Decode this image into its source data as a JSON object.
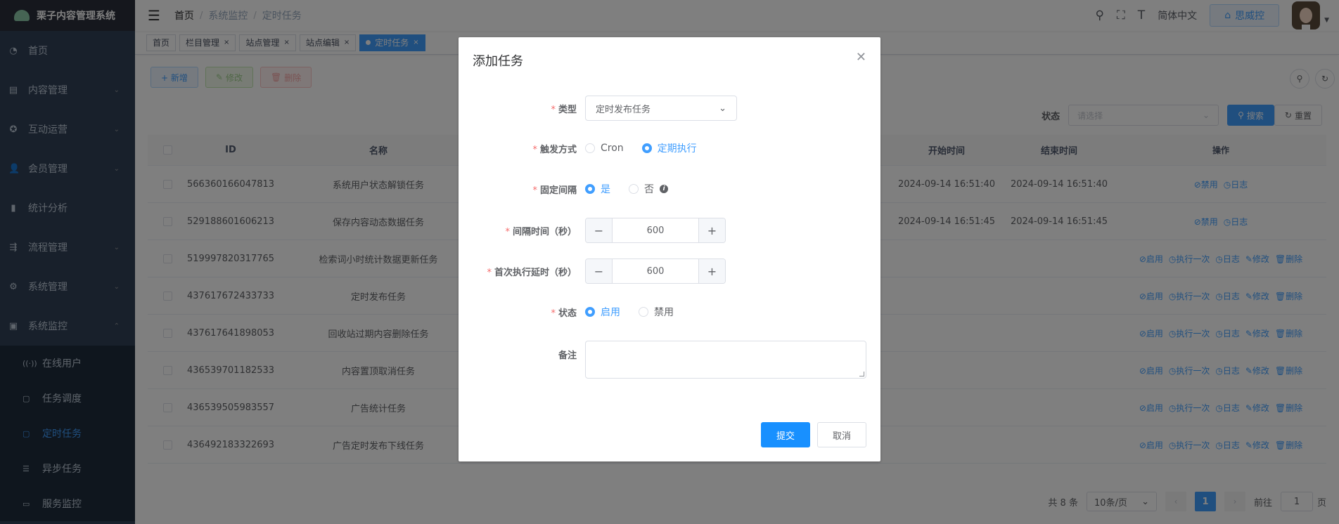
{
  "app": {
    "title": "栗子内容管理系统"
  },
  "sidebar": {
    "items": [
      {
        "label": "首页",
        "icon": "dashboard-icon",
        "glyph": "◔"
      },
      {
        "label": "内容管理",
        "icon": "document-icon",
        "glyph": "▤"
      },
      {
        "label": "互动运营",
        "icon": "interaction-icon",
        "glyph": "✪"
      },
      {
        "label": "会员管理",
        "icon": "user-icon",
        "glyph": "👤"
      },
      {
        "label": "统计分析",
        "icon": "chart-icon",
        "glyph": "▮"
      },
      {
        "label": "流程管理",
        "icon": "flow-icon",
        "glyph": "⇶"
      },
      {
        "label": "系统管理",
        "icon": "gear-icon",
        "glyph": "⚙"
      },
      {
        "label": "系统监控",
        "icon": "monitor-icon",
        "glyph": "▣"
      }
    ],
    "submenu": [
      {
        "label": "在线用户",
        "icon": "online-icon",
        "glyph": "((·))"
      },
      {
        "label": "任务调度",
        "icon": "schedule-icon",
        "glyph": "▢"
      },
      {
        "label": "定时任务",
        "icon": "timer-icon",
        "glyph": "▢"
      },
      {
        "label": "异步任务",
        "icon": "list-icon",
        "glyph": "☰"
      },
      {
        "label": "服务监控",
        "icon": "server-icon",
        "glyph": "▭"
      }
    ]
  },
  "navbar": {
    "breadcrumb": [
      "首页",
      "系统监控",
      "定时任务"
    ],
    "breadcrumb_sep": "/",
    "language": "简体中文",
    "portal_label": "思威控"
  },
  "tags": [
    {
      "label": "首页"
    },
    {
      "label": "栏目管理"
    },
    {
      "label": "站点管理"
    },
    {
      "label": "站点编辑"
    },
    {
      "label": "定时任务"
    }
  ],
  "toolbar": {
    "add": "+ 新增",
    "edit": "修改",
    "delete": "删除"
  },
  "filter": {
    "label": "状态",
    "placeholder": "请选择",
    "search": "搜索",
    "reset": "重置"
  },
  "table": {
    "headers": {
      "id": "ID",
      "name": "名称",
      "start": "开始时间",
      "end": "结束时间",
      "ops": "操作"
    },
    "rows": [
      {
        "id": "566360166047813",
        "name": "系统用户状态解锁任务",
        "start": "2024-09-14 16:51:40",
        "end": "2024-09-14 16:51:40",
        "ops": [
          "⊘禁用",
          "◷日志"
        ]
      },
      {
        "id": "529188601606213",
        "name": "保存内容动态数据任务",
        "start": "2024-09-14 16:51:45",
        "end": "2024-09-14 16:51:45",
        "ops": [
          "⊘禁用",
          "◷日志"
        ]
      },
      {
        "id": "519997820317765",
        "name": "检索词小时统计数据更新任务",
        "start": "",
        "end": "",
        "ops": [
          "⊘启用",
          "◷执行一次",
          "◷日志",
          "✎修改",
          "🗑删除"
        ]
      },
      {
        "id": "437617672433733",
        "name": "定时发布任务",
        "start": "",
        "end": "",
        "ops": [
          "⊘启用",
          "◷执行一次",
          "◷日志",
          "✎修改",
          "🗑删除"
        ]
      },
      {
        "id": "437617641898053",
        "name": "回收站过期内容删除任务",
        "start": "",
        "end": "",
        "ops": [
          "⊘启用",
          "◷执行一次",
          "◷日志",
          "✎修改",
          "🗑删除"
        ]
      },
      {
        "id": "436539701182533",
        "name": "内容置顶取消任务",
        "start": "",
        "end": "",
        "ops": [
          "⊘启用",
          "◷执行一次",
          "◷日志",
          "✎修改",
          "🗑删除"
        ]
      },
      {
        "id": "436539505983557",
        "name": "广告统计任务",
        "start": "",
        "end": "",
        "ops": [
          "⊘启用",
          "◷执行一次",
          "◷日志",
          "✎修改",
          "🗑删除"
        ]
      },
      {
        "id": "436492183322693",
        "name": "广告定时发布下线任务",
        "start": "",
        "end": "",
        "ops": [
          "⊘启用",
          "◷执行一次",
          "◷日志",
          "✎修改",
          "🗑删除"
        ]
      }
    ]
  },
  "pagination": {
    "total": "共 8 条",
    "page_size": "10条/页",
    "current": "1",
    "goto_prefix": "前往",
    "goto_value": "1",
    "goto_suffix": "页"
  },
  "dialog": {
    "title": "添加任务",
    "type_label": "类型",
    "type_value": "定时发布任务",
    "trigger_label": "触发方式",
    "trigger_options": [
      "Cron",
      "定期执行"
    ],
    "fixed_label": "固定间隔",
    "fixed_options": [
      "是",
      "否"
    ],
    "interval_label": "间隔时间（秒）",
    "interval_value": "600",
    "delay_label": "首次执行延时（秒）",
    "delay_value": "600",
    "status_label": "状态",
    "status_options": [
      "启用",
      "禁用"
    ],
    "remark_label": "备注",
    "submit": "提交",
    "cancel": "取消"
  },
  "colors": {
    "primary": "#1890ff",
    "sidebar_bg": "#304156",
    "active_menu": "#409eff"
  }
}
